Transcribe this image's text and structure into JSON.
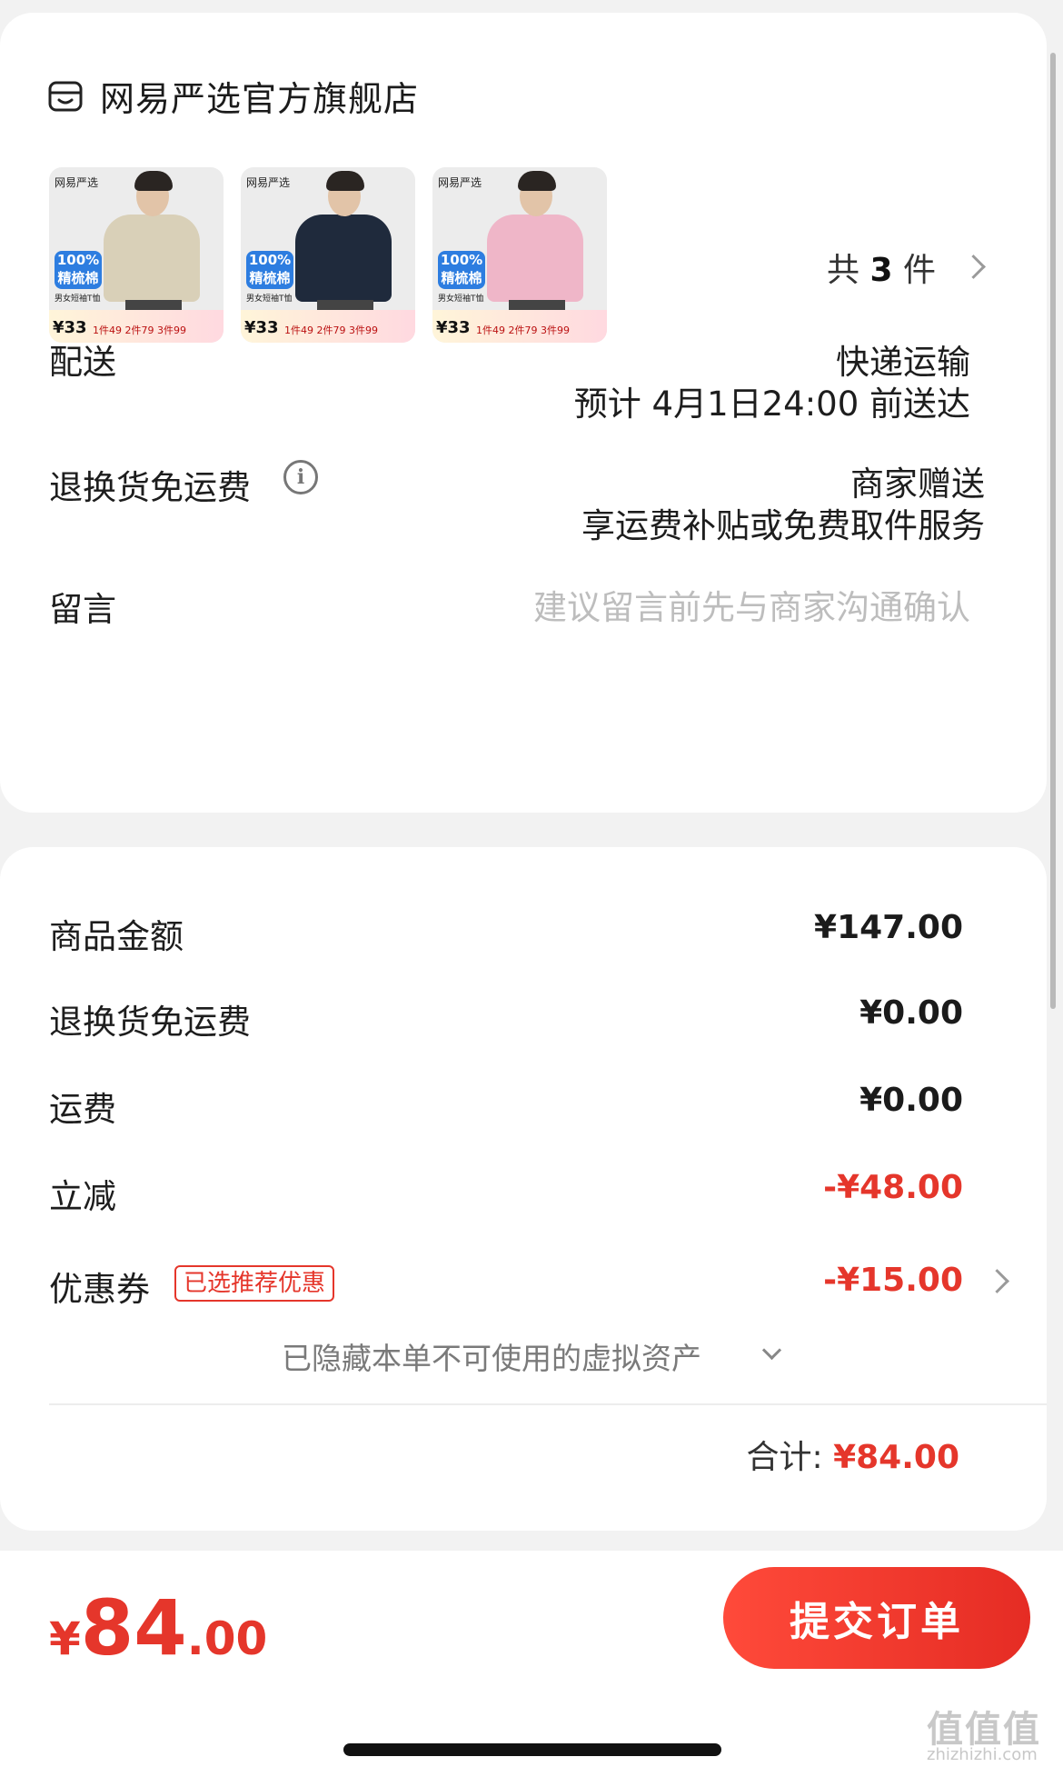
{
  "store": {
    "name": "网易严选官方旗舰店",
    "icon": "store-icon"
  },
  "products": [
    {
      "brand": "网易严选",
      "badge": "100%\n精梳棉",
      "tag": "男女短袖T恤",
      "price": "¥33",
      "promo": "1件49 2件79 3件99",
      "shirt_color": "#d9d0b8"
    },
    {
      "brand": "网易严选",
      "badge": "100%\n精梳棉",
      "tag": "男女短袖T恤",
      "price": "¥33",
      "promo": "1件49 2件79 3件99",
      "shirt_color": "#1f2a3c"
    },
    {
      "brand": "网易严选",
      "badge": "100%\n精梳棉",
      "tag": "男女短袖T恤",
      "price": "¥33",
      "promo": "1件49 2件79 3件99",
      "shirt_color": "#efb6c8"
    }
  ],
  "count": {
    "prefix": "共",
    "num": "3",
    "suffix": "件"
  },
  "delivery": {
    "label": "配送",
    "method": "快递运输",
    "eta": "预计 4月1日24:00 前送达"
  },
  "return_shipping": {
    "label": "退换货免运费",
    "value1": "商家赠送",
    "value2": "享运费补贴或免费取件服务"
  },
  "message": {
    "label": "留言",
    "placeholder": "建议留言前先与商家沟通确认"
  },
  "summary": {
    "goods_label": "商品金额",
    "goods_value": "¥147.00",
    "return_label": "退换货免运费",
    "return_value": "¥0.00",
    "freight_label": "运费",
    "freight_value": "¥0.00",
    "discount_label": "立减",
    "discount_value": "-¥48.00",
    "coupon_label": "优惠券",
    "coupon_tag": "已选推荐优惠",
    "coupon_value": "-¥15.00",
    "hidden_note": "已隐藏本单不可使用的虚拟资产",
    "total_label": "合计:",
    "total_value": "¥84.00"
  },
  "footer": {
    "price_symbol": "¥",
    "price_int": "84",
    "price_dec": ".00",
    "submit_label": "提交订单"
  },
  "watermark": {
    "text": "值值值",
    "sub": "zhizhizhi.com"
  },
  "colors": {
    "accent": "#e5362b",
    "background": "#f2f2f2"
  }
}
